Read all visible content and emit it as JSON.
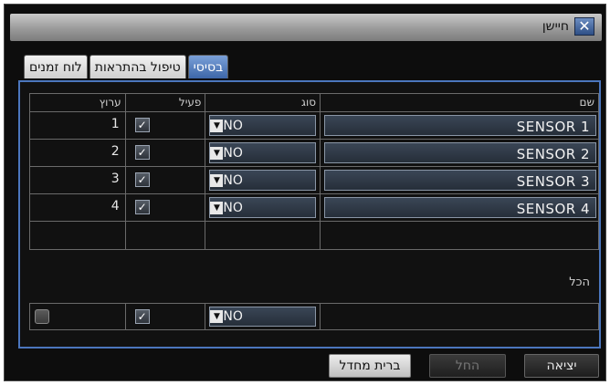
{
  "window": {
    "title": "חיישן",
    "close_icon": "close-icon"
  },
  "tabs": [
    {
      "label": "בסיסי",
      "active": true
    },
    {
      "label": "טיפול בהתראות",
      "active": false
    },
    {
      "label": "לוח זמנים",
      "active": false
    }
  ],
  "table": {
    "headers": {
      "name": "שם",
      "type": "סוג",
      "active": "פעיל",
      "alarm": "ערוץ"
    },
    "rows": [
      {
        "name": "SENSOR 1",
        "type": "NO",
        "active": true,
        "alarm": "1"
      },
      {
        "name": "SENSOR 2",
        "type": "NO",
        "active": true,
        "alarm": "2"
      },
      {
        "name": "SENSOR 3",
        "type": "NO",
        "active": true,
        "alarm": "3"
      },
      {
        "name": "SENSOR 4",
        "type": "NO",
        "active": true,
        "alarm": "4"
      }
    ]
  },
  "all": {
    "label": "הכל",
    "type": "NO",
    "active": true,
    "alarm_checked": false
  },
  "buttons": {
    "default": "ברית מחדל",
    "apply": "החל",
    "exit": "יציאה"
  },
  "colors": {
    "accent": "#4b76bd",
    "tab_active": "#3d66a8",
    "background": "#111111"
  }
}
